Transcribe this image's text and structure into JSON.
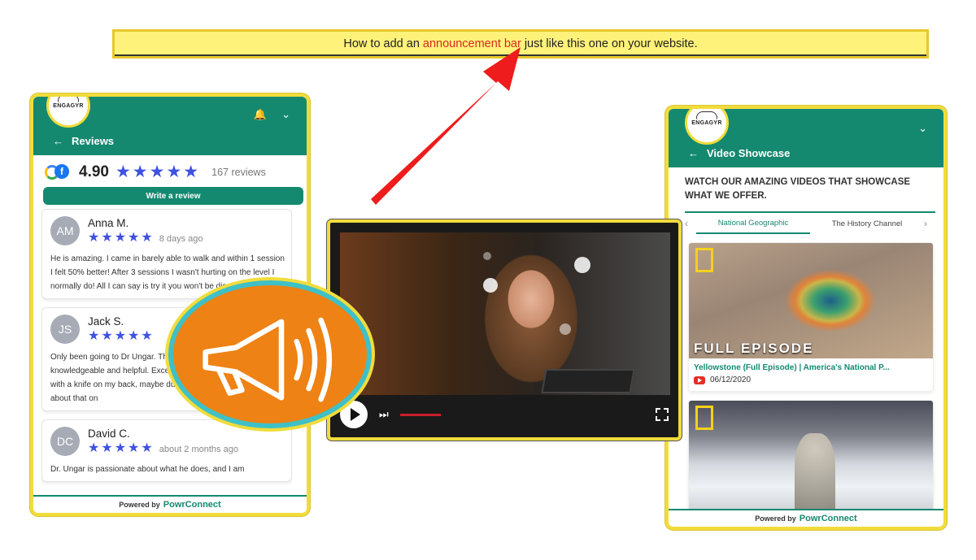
{
  "announcement": {
    "prefix": "How to add an",
    "highlight": "announcement bar",
    "suffix": "just like this one on your website."
  },
  "reviews_widget": {
    "logo_text": "ENGAGYR",
    "back_title": "Reviews",
    "score": "4.90",
    "review_count": "167 reviews",
    "write_button": "Write a review",
    "reviews": [
      {
        "initials": "AM",
        "name": "Anna M.",
        "time": "8 days ago",
        "text": "He is amazing. I came in barely able to walk and within 1 session I felt 50% better! After 3 sessions I wasn't hurting on the level I normally do! All I can say is try it you won't be disappointed"
      },
      {
        "initials": "JS",
        "name": "Jack S.",
        "time": "",
        "text": "Only been going to Dr Ungar. The staff are friendly and knowledgeable and helpful. Except I woke up today feeling stuck with a knife on my back, maybe due to the orthotics. Will talk about that on"
      },
      {
        "initials": "DC",
        "name": "David C.",
        "time": "about 2 months ago",
        "text": "Dr. Ungar is passionate about what he does, and I am"
      }
    ],
    "powered_by": "Powered by",
    "brand": "PowrConnect"
  },
  "video_widget": {
    "logo_text": "ENGAGYR",
    "back_title": "Video Showcase",
    "intro": "WATCH OUR AMAZING VIDEOS THAT SHOWCASE WHAT WE OFFER.",
    "tabs": [
      "National Geographic",
      "The History Channel"
    ],
    "videos": [
      {
        "overlay": "FULL EPISODE",
        "title": "Yellowstone (Full Episode) | America's National P...",
        "date": "06/12/2020"
      }
    ],
    "powered_by": "Powered by",
    "brand": "PowrConnect"
  },
  "colors": {
    "teal": "#148970",
    "highlight_yellow": "#fff27a",
    "border_yellow": "#f1dc3c",
    "star_blue": "#3f51e0",
    "accent_red": "#d32a1e",
    "megaphone_orange": "#ee8214"
  }
}
